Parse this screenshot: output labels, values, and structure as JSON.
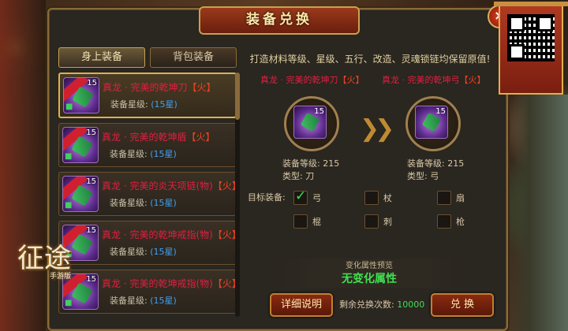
{
  "window": {
    "title": "装备兑换",
    "close_label": "×"
  },
  "tabs": [
    {
      "label": "身上装备",
      "active": true
    },
    {
      "label": "背包装备",
      "active": false
    }
  ],
  "items": [
    {
      "name": "真龙 · 完美的乾坤刀",
      "tag": "【火】",
      "star_label": "装备星级:",
      "star_value": "(15星)",
      "level": "15"
    },
    {
      "name": "真龙 · 完美的乾坤盾",
      "tag": "【火】",
      "star_label": "装备星级:",
      "star_value": "(15星)",
      "level": "15"
    },
    {
      "name": "真龙 · 完美的炎天项链(物)",
      "tag": "【火】",
      "star_label": "装备星级:",
      "star_value": "(15星)",
      "level": "15"
    },
    {
      "name": "真龙 · 完美的乾坤戒指(物)",
      "tag": "【火】",
      "star_label": "装备星级:",
      "star_value": "(15星)",
      "level": "15"
    },
    {
      "name": "真龙 · 完美的乾坤戒指(物)",
      "tag": "【火】",
      "star_label": "装备星级:",
      "star_value": "(15星)",
      "level": "15"
    }
  ],
  "note": "打造材料等级、星级、五行、改造、灵魂锁链均保留原值!",
  "source": {
    "name": "真龙 · 完美的乾坤刀",
    "tag": "【火】",
    "level_line": "装备等级: 215",
    "type_line": "类型: 刀",
    "level": "15"
  },
  "target": {
    "name": "真龙 · 完美的乾坤弓",
    "tag": "【火】",
    "level_line": "装备等级: 215",
    "type_line": "类型: 弓",
    "level": "15"
  },
  "target_label": "目标装备:",
  "options": [
    {
      "label": "弓",
      "checked": true
    },
    {
      "label": "杖",
      "checked": false
    },
    {
      "label": "扇",
      "checked": false
    },
    {
      "label": "棍",
      "checked": false
    },
    {
      "label": "刺",
      "checked": false
    },
    {
      "label": "枪",
      "checked": false
    }
  ],
  "preview": {
    "title": "变化属性预览",
    "value": "无变化属性"
  },
  "buttons": {
    "detail": "详细说明",
    "exchange": "兑 换"
  },
  "remaining": {
    "label": "剩余兑换次数:",
    "value": "10000"
  },
  "logo": {
    "text": "征途",
    "sub": "手游版"
  },
  "colors": {
    "item_name": "#e02040",
    "star_value": "#40a0f0",
    "highlight_green": "#40e050",
    "gold_border": "#c8a050"
  }
}
